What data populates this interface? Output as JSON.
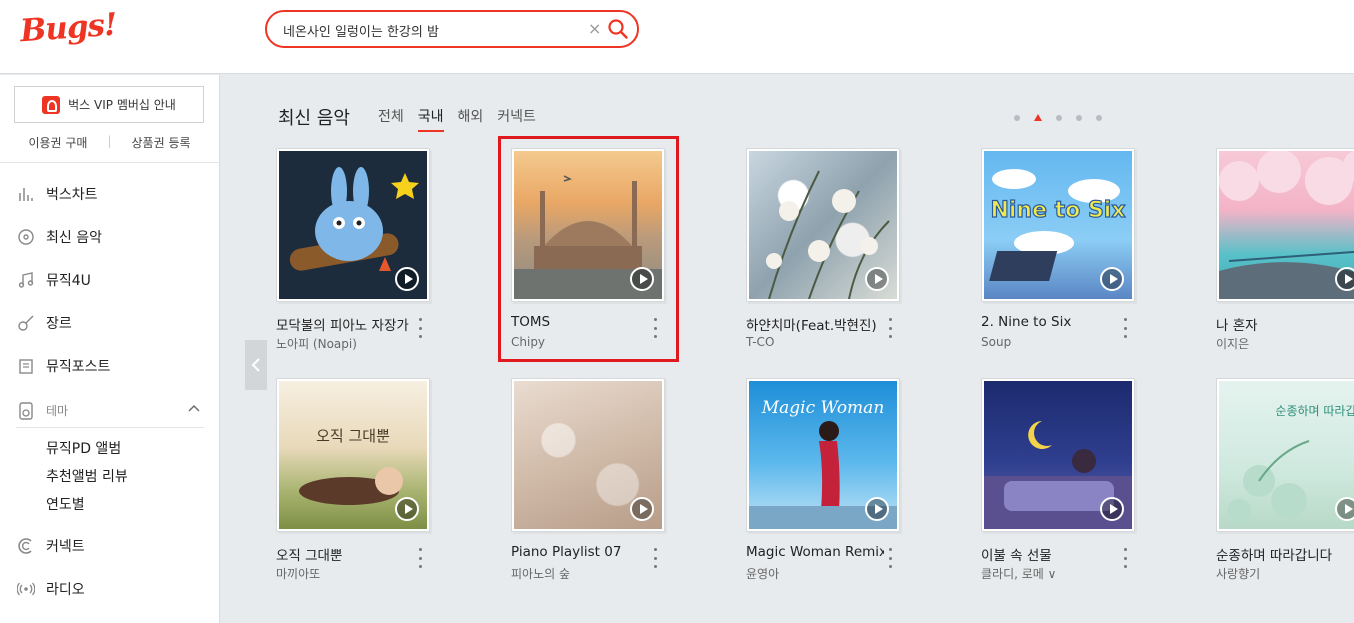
{
  "header": {
    "logo": "Bugs!",
    "search": {
      "value": "네온사인 일렁이는 한강의 밤",
      "clear_icon": "×"
    }
  },
  "sidebar": {
    "vip_button": "벅스 VIP 멤버십 안내",
    "sub_links": [
      "이용권 구매",
      "상품권 등록"
    ],
    "nav": [
      {
        "label": "벅스차트",
        "icon": "chart-bars-icon"
      },
      {
        "label": "최신 음악",
        "icon": "disc-icon"
      },
      {
        "label": "뮤직4U",
        "icon": "music-note-icon"
      },
      {
        "label": "장르",
        "icon": "guitar-icon"
      },
      {
        "label": "뮤직포스트",
        "icon": "post-icon"
      }
    ],
    "theme": {
      "label": "테마",
      "icon": "speaker-icon"
    },
    "theme_items": [
      "뮤직PD 앨범",
      "추천앨범 리뷰",
      "연도별"
    ],
    "nav_bottom": [
      {
        "label": "커넥트",
        "icon": "connect-icon"
      },
      {
        "label": "라디오",
        "icon": "radio-icon"
      }
    ]
  },
  "main": {
    "section_title": "최신 음악",
    "tabs": [
      "전체",
      "국내",
      "해외",
      "커넥트"
    ],
    "active_tab": "국내",
    "pager": {
      "pages": 5,
      "active": 2
    },
    "albums": [
      {
        "title": "모닥불의 피아노 자장가",
        "artist": "노아피 (Noapi)"
      },
      {
        "title": "TOMS",
        "artist": "Chipy"
      },
      {
        "title": "하얀치마(Feat.박현진)",
        "artist": "T-CO"
      },
      {
        "title": "2. Nine to Six",
        "artist": "Soup",
        "cover_text": "Nine to Six"
      },
      {
        "title": "나 혼자",
        "artist": "이지은"
      },
      {
        "title": "오직 그대뿐",
        "artist": "마끼아또",
        "cover_text": "오직 그대뿐"
      },
      {
        "title": "Piano Playlist 07",
        "artist": "피아노의 숲"
      },
      {
        "title": "Magic Woman Remix",
        "artist": "윤영아",
        "cover_text": "Magic Woman"
      },
      {
        "title": "이불 속 선물",
        "artist": "클라디, 로메 ∨"
      },
      {
        "title": "순종하며 따라갑니다",
        "artist": "사랑향기",
        "cover_text": "순종하며 따라갑니다"
      }
    ]
  }
}
